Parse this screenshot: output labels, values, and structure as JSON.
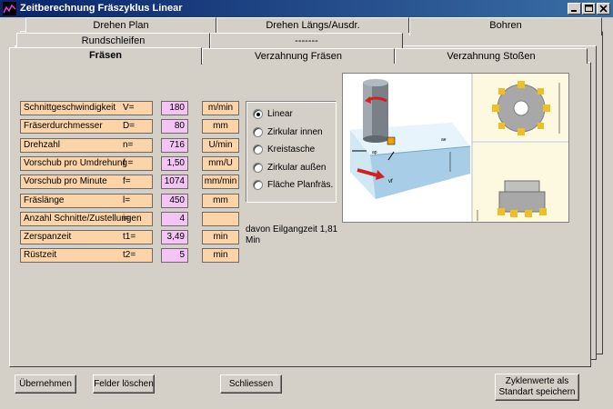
{
  "window": {
    "title": "Zeitberechnung Fräszyklus Linear"
  },
  "tabs": {
    "row1": [
      "Drehen Plan",
      "Drehen Längs/Ausdr.",
      "Bohren"
    ],
    "row2": [
      "Rundschleifen",
      "-------"
    ],
    "row3": [
      "Fräsen",
      "Verzahnung Fräsen",
      "Verzahnung Stoßen"
    ]
  },
  "fields": [
    {
      "label": "Schnittgeschwindigkeit",
      "symbol": "V=",
      "value": "180",
      "unit": "m/min"
    },
    {
      "label": "Fräserdurchmesser",
      "symbol": "D=",
      "value": "80",
      "unit": "mm"
    },
    {
      "label": "Drehzahl",
      "symbol": "n=",
      "value": "716",
      "unit": "U/min"
    },
    {
      "label": "Vorschub pro Umdrehung",
      "symbol": "f =",
      "value": "1,50",
      "unit": "mm/U"
    },
    {
      "label": "Vorschub pro Minute",
      "symbol": "f=",
      "value": "1074",
      "unit": "mm/min"
    },
    {
      "label": "Fräslänge",
      "symbol": "l=",
      "value": "450",
      "unit": "mm"
    },
    {
      "label": "Anzahl Schnitte/Zustellungen",
      "symbol": "i=",
      "value": "4",
      "unit": ""
    },
    {
      "label": "Zerspanzeit",
      "symbol": "t1=",
      "value": "3,49",
      "unit": "min"
    },
    {
      "label": "Rüstzeit",
      "symbol": "t2=",
      "value": "5",
      "unit": "min"
    }
  ],
  "modes": {
    "selected": 0,
    "options": [
      "Linear",
      "Zirkular innen",
      "Kreistasche",
      "Zirkular außen",
      "Fläche Planfräs."
    ]
  },
  "info": {
    "eilgang_line1": "davon Eilgangzeit  1,81",
    "eilgang_line2": "Min"
  },
  "buttons": {
    "apply": "Übernehmen",
    "clear": "Felder löschen",
    "close": "Schliessen",
    "save_line1": "Zyklenwerte als",
    "save_line2": "Standart speichern"
  },
  "colors": {
    "label_bg": "#fcd4a8",
    "value_bg": "#f4c4f4",
    "titlebar": "#0a246a"
  }
}
